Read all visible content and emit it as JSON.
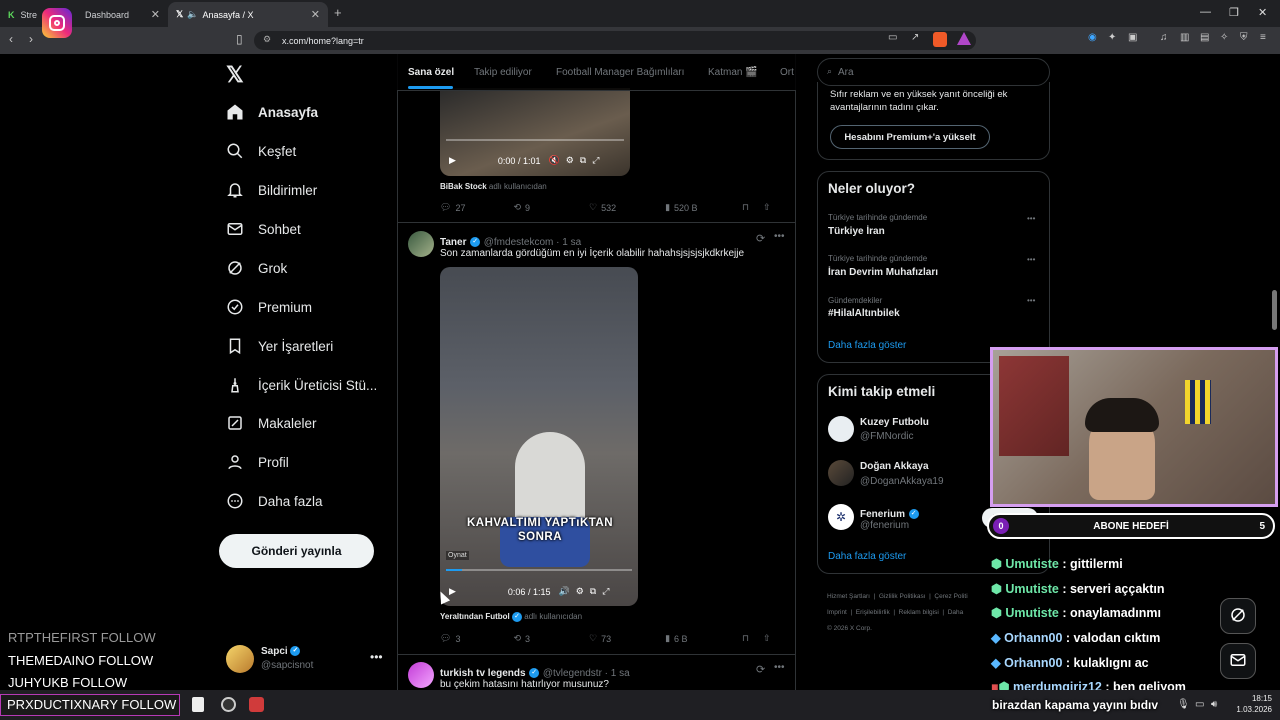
{
  "browser": {
    "tabs": [
      {
        "label": "Stre",
        "label2": "Dashboard"
      },
      {
        "label": "Anasayfa / X"
      }
    ],
    "url": "x.com/home?lang=tr"
  },
  "sidebar": {
    "items": [
      {
        "label": "Anasayfa",
        "icon": "home-icon"
      },
      {
        "label": "Keşfet",
        "icon": "search-icon"
      },
      {
        "label": "Bildirimler",
        "icon": "bell-icon"
      },
      {
        "label": "Sohbet",
        "icon": "mail-icon"
      },
      {
        "label": "Grok",
        "icon": "grok-icon"
      },
      {
        "label": "Premium",
        "icon": "premium-icon"
      },
      {
        "label": "Yer İşaretleri",
        "icon": "bookmark-icon"
      },
      {
        "label": "İçerik Üreticisi Stü...",
        "icon": "creator-icon"
      },
      {
        "label": "Makaleler",
        "icon": "article-icon"
      },
      {
        "label": "Profil",
        "icon": "profile-icon"
      },
      {
        "label": "Daha fazla",
        "icon": "more-icon"
      }
    ],
    "post_button": "Gönderi yayınla",
    "account": {
      "name": "Sapci",
      "handle": "@sapcisnot"
    }
  },
  "feed": {
    "tabs": [
      "Sana özel",
      "Takip ediliyor",
      "Football Manager Bağımlıları",
      "Katman 🎬",
      "Ort"
    ],
    "tweet0": {
      "video_time": "0:00 / 1:01",
      "source_name": "BiBak Stock",
      "source_suffix": "adlı kullanıcıdan",
      "replies": "27",
      "retweets": "9",
      "likes": "532",
      "views": "520 B"
    },
    "tweet1": {
      "name": "Taner",
      "handle": "@fmdestekcom · 1 sa",
      "text": "Son zamanlarda gördüğüm en iyi İçerik olabilir hahahsjsjsjsjkdkrkejje",
      "caption": "KAHVALTIMI YAPTıKTAN SONRA",
      "play_label": "Oynat",
      "video_time": "0:06 / 1:15",
      "source_name": "Yeraltından Futbol",
      "source_suffix": "adlı kullanıcıdan",
      "replies": "3",
      "retweets": "3",
      "likes": "73",
      "views": "6 B"
    },
    "tweet2": {
      "name": "turkish tv legends",
      "handle": "@tvlegendstr · 1 sa",
      "text": "bu çekim hatasını hatırlıyor musunuz?"
    }
  },
  "right": {
    "search_placeholder": "Ara",
    "premium_text": "Sıfır reklam ve en yüksek yanıt önceliği ek avantajlarının tadını çıkar.",
    "premium_button": "Hesabını Premium+'a yükselt",
    "trends_title": "Neler oluyor?",
    "trends": [
      {
        "meta": "Türkiye tarihinde gündemde",
        "name": "Türkiye İran"
      },
      {
        "meta": "Türkiye tarihinde gündemde",
        "name": "İran Devrim Muhafızları"
      },
      {
        "meta": "Gündemdekiler",
        "name": "#HilalAltınbilek"
      }
    ],
    "show_more": "Daha fazla göster",
    "who_title": "Kimi takip etmeli",
    "who": [
      {
        "name": "Kuzey Futbolu",
        "handle": "@FMNordic"
      },
      {
        "name": "Doğan Akkaya",
        "handle": "@DoganAkkaya19"
      },
      {
        "name": "Fenerium",
        "handle": "@fenerium"
      }
    ],
    "follow_label": "Takip et",
    "who_more": "Daha fazla göster",
    "footer": [
      "Hizmet Şartları",
      "Gizlilik Politikası",
      "Çerez Politi",
      "Imprint",
      "Erişilebilirlik",
      "Reklam bilgisi",
      "Daha",
      "© 2026 X Corp."
    ]
  },
  "stream": {
    "goal_left": "0",
    "goal_label": "ABONE HEDEFİ",
    "goal_right": "5",
    "chat": [
      {
        "user": "Umutiste",
        "msg": " : gittilermi",
        "color": "#6ee7a8"
      },
      {
        "user": "Umutiste",
        "msg": " : serveri aççaktın",
        "color": "#6ee7a8"
      },
      {
        "user": "Umutiste",
        "msg": " : onaylamadınmı",
        "color": "#6ee7a8"
      },
      {
        "user": "Orhann00",
        "msg": " : valodan cıktım",
        "color": "#a9d8ff"
      },
      {
        "user": "Orhann00",
        "msg": " : kulaklıgnı ac",
        "color": "#a9d8ff"
      },
      {
        "user": "merdumgiriz12",
        "msg": " : ben geliyom",
        "color": "#a9d8ff"
      },
      {
        "user": "",
        "msg": "birazdan kapama yayını bıdıv",
        "color": "#ffffff"
      }
    ],
    "follows": [
      "RTPTHEFIRST  FOLLOW",
      "THEMEDAINO  FOLLOW",
      "JUHYUKB  FOLLOW",
      "PRXDUCTIXNARY  FOLLOW"
    ]
  },
  "taskbar": {
    "time": "18:15",
    "date": "1.03.2026"
  }
}
